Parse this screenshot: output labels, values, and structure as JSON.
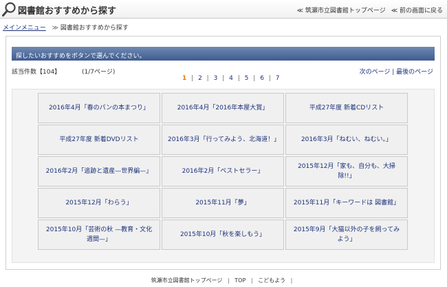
{
  "header": {
    "title": "図書館おすすめから探す",
    "links": [
      "≪ 筑瀬市立図書館トップページ",
      "≪ 前の画面に戻る"
    ]
  },
  "breadcrumb": {
    "home": "メインメニュー",
    "separator": "≫",
    "current": "図書館おすすめから探す"
  },
  "instruction": "探したいおすすめをボタンで選んでください。",
  "results": {
    "count": "該当件数【104】",
    "page_info": "(1/7ページ)",
    "next_page": "次のページ",
    "last_page": "最後のページ"
  },
  "pager": {
    "current": "1",
    "pages": [
      "2",
      "3",
      "4",
      "5",
      "6",
      "7"
    ]
  },
  "items": [
    "2016年4月「春のパンの本まつり」",
    "2016年4月「2016年本屋大賞」",
    "平成27年度 新着CDリスト",
    "平成27年度 新着DVDリスト",
    "2016年3月「行ってみよう、北海道！」",
    "2016年3月「ねむい、ねむい。」",
    "2016年2月「追跡と遺産—世界編—」",
    "2016年2月「ベストセラー」",
    "2015年12月「家も、自分も、大掃除!!」",
    "2015年12月「わらう」",
    "2015年11月「夢」",
    "2015年11月「キーワードは 図書館」",
    "2015年10月「芸術の秋 —教育・文化週間—」",
    "2015年10月「秋を楽しもう」",
    "2015年9月「大猫以外の子を飼ってみよう」"
  ],
  "footer": {
    "links": [
      "筑瀬市立図書館トップページ",
      "TOP",
      "こどもよう"
    ],
    "separator": "|"
  },
  "colors": {
    "bar_gradient_top": "#6f89b3",
    "bar_gradient_bottom": "#3f5c8f",
    "link": "#1b2f7a",
    "current_page": "#e07a10"
  },
  "icons": {
    "logo": "magnifier-icon"
  }
}
